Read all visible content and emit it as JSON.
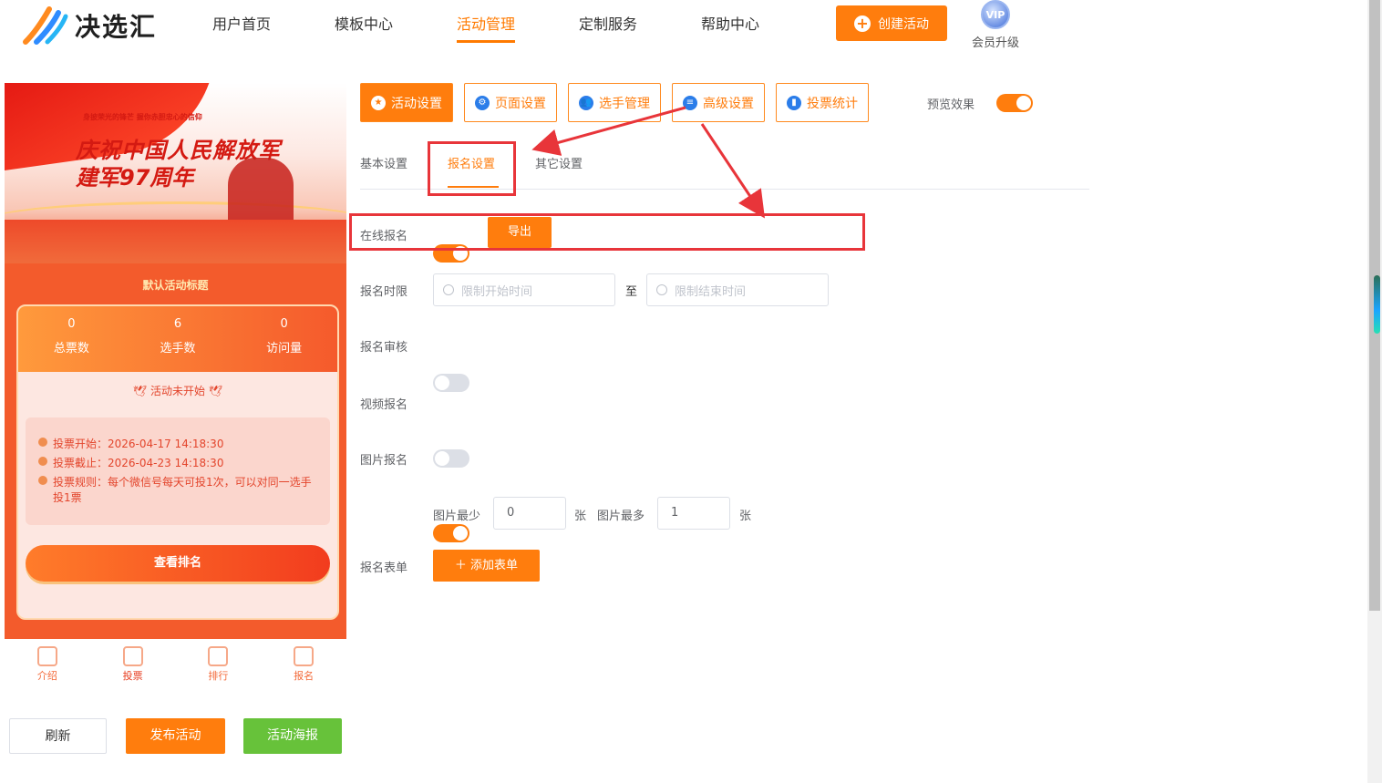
{
  "header": {
    "brand": "决选汇",
    "nav": [
      "用户首页",
      "模板中心",
      "活动管理",
      "定制服务",
      "帮助中心"
    ],
    "active_nav": "活动管理",
    "create_label": "创建活动",
    "vip_badge": "VIP",
    "vip_label": "会员升级"
  },
  "preview": {
    "banner_slogan": "身披荣光的锋芒 握你赤胆忠心的信仰",
    "banner_title_line1": "庆祝中国人民解放军",
    "banner_title_line2": "建军97周年",
    "activity_title": "默认活动标题",
    "stats": [
      {
        "value": "0",
        "label": "总票数"
      },
      {
        "value": "6",
        "label": "选手数"
      },
      {
        "value": "0",
        "label": "访问量"
      }
    ],
    "status": "活动未开始",
    "info": {
      "start": "投票开始：2026-04-17 14:18:30",
      "end": "投票截止：2026-04-23 14:18:30",
      "rule": "投票规则：每个微信号每天可投1次，可以对同一选手投1票"
    },
    "rank_button": "查看排名",
    "tabbar": [
      "介绍",
      "投票",
      "排行",
      "报名"
    ]
  },
  "bottom_buttons": {
    "refresh": "刷新",
    "publish": "发布活动",
    "poster": "活动海报"
  },
  "toolbar": {
    "buttons": [
      "活动设置",
      "页面设置",
      "选手管理",
      "高级设置",
      "投票统计"
    ],
    "preview_label": "预览效果",
    "preview_on": true
  },
  "subtabs": [
    "基本设置",
    "报名设置",
    "其它设置"
  ],
  "active_subtab": "报名设置",
  "form": {
    "online_signup": {
      "label": "在线报名",
      "on": true,
      "export_label": "导出"
    },
    "signup_period": {
      "label": "报名时限",
      "start_placeholder": "限制开始时间",
      "separator": "至",
      "end_placeholder": "限制结束时间"
    },
    "signup_review": {
      "label": "报名审核",
      "on": false
    },
    "video_signup": {
      "label": "视频报名",
      "on": false
    },
    "image_signup": {
      "label": "图片报名",
      "on": true
    },
    "image_min": {
      "label": "图片最少",
      "value": "0",
      "unit": "张"
    },
    "image_max": {
      "label": "图片最多",
      "value": "1",
      "unit": "张"
    },
    "signup_form": {
      "label": "报名表单",
      "button": "＋ 添加表单"
    }
  },
  "colors": {
    "accent": "#ff7d0d",
    "annotation": "#e8353a",
    "green": "#67c23a"
  }
}
